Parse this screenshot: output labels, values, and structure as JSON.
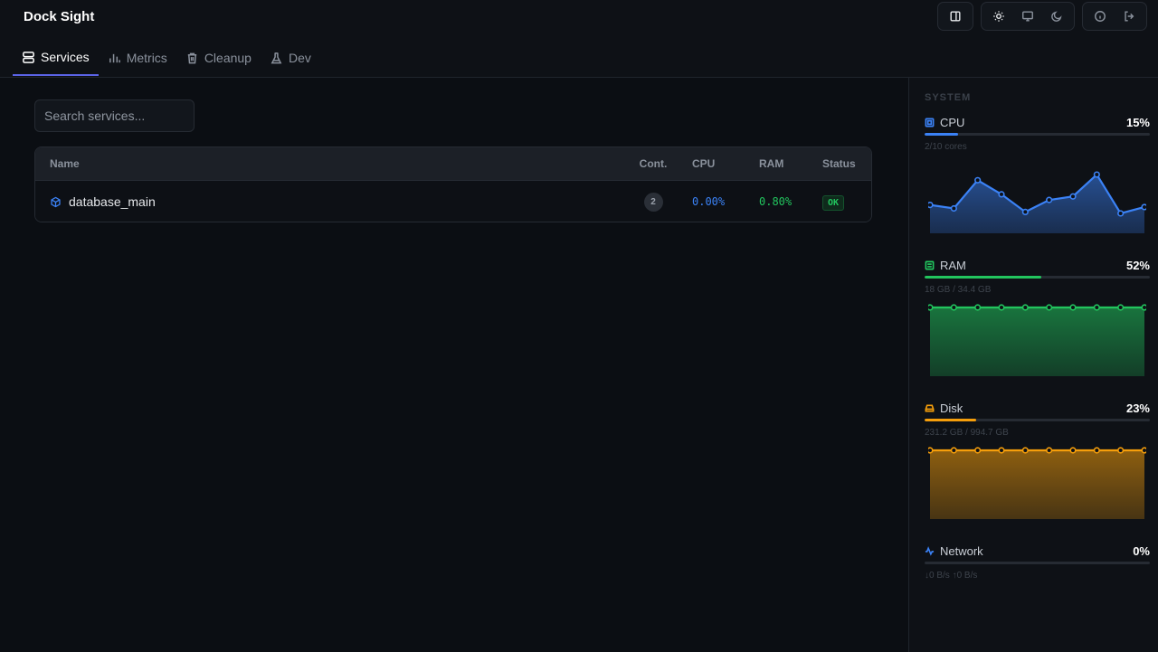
{
  "app": {
    "title": "Dock Sight"
  },
  "tabs": [
    {
      "label": "Services",
      "icon": "server-icon",
      "active": true
    },
    {
      "label": "Metrics",
      "icon": "bar-chart-icon",
      "active": false
    },
    {
      "label": "Cleanup",
      "icon": "trash-icon",
      "active": false
    },
    {
      "label": "Dev",
      "icon": "flask-icon",
      "active": false
    }
  ],
  "toolbar": {
    "layout_icon": "sidebar-toggle-icon",
    "theme_icons": [
      "sun-icon",
      "monitor-icon",
      "moon-icon"
    ],
    "misc_icons": [
      "info-icon",
      "logout-icon"
    ]
  },
  "search": {
    "placeholder": "Search services...",
    "value": ""
  },
  "table": {
    "columns": [
      "Name",
      "Cont.",
      "CPU",
      "RAM",
      "Status"
    ],
    "rows": [
      {
        "name": "database_main",
        "icon": "cube-icon",
        "containers": "2",
        "cpu": "0.00%",
        "ram": "0.80%",
        "status": "OK"
      }
    ]
  },
  "sidebar": {
    "section_label": "SYSTEM",
    "metrics": [
      {
        "name": "CPU",
        "percent_label": "15%",
        "percent": 15,
        "sub": "2/10 cores",
        "color": "#3b82f6",
        "icon": "cpu-icon",
        "history": [
          30,
          25,
          65,
          45,
          20,
          37,
          42,
          73,
          18,
          27
        ]
      },
      {
        "name": "RAM",
        "percent_label": "52%",
        "percent": 52,
        "sub": "18 GB / 34.4 GB",
        "color": "#22c55e",
        "icon": "memory-icon",
        "history": [
          52,
          52,
          52,
          52,
          52,
          52,
          52,
          52,
          52,
          52
        ]
      },
      {
        "name": "Disk",
        "percent_label": "23%",
        "percent": 23,
        "sub": "231.2 GB / 994.7 GB",
        "color": "#f59e0b",
        "icon": "disk-icon",
        "history": [
          23,
          23,
          23,
          23,
          23,
          23,
          23,
          23,
          23,
          23
        ]
      },
      {
        "name": "Network",
        "percent_label": "0%",
        "percent": 0,
        "sub": "↓0 B/s ↑0 B/s",
        "color": "#3b82f6",
        "icon": "activity-icon",
        "history": []
      }
    ]
  }
}
